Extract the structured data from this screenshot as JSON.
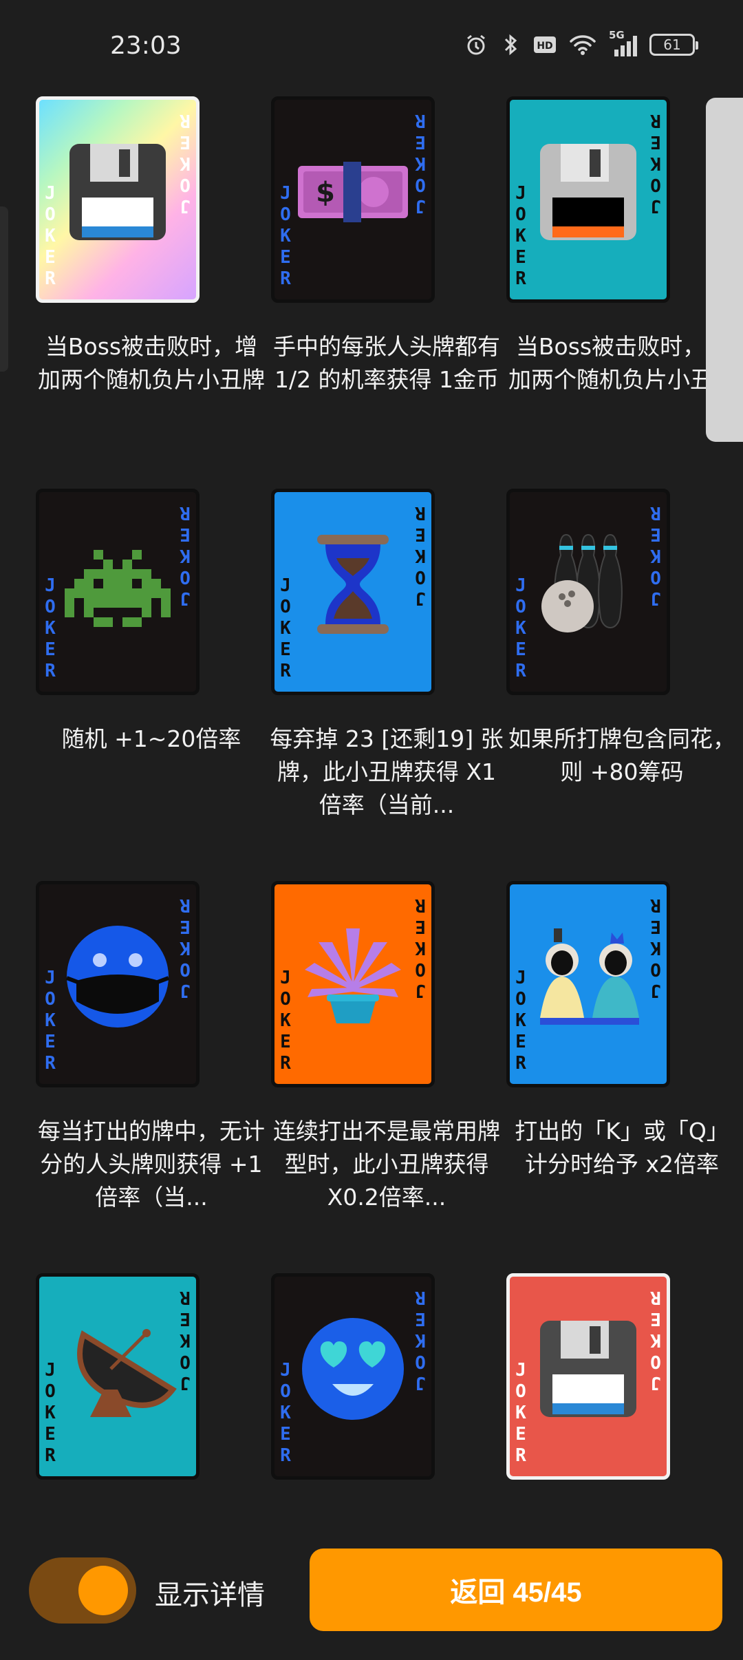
{
  "status_bar": {
    "time": "23:03",
    "battery": "61",
    "network": "5G",
    "icons": [
      "alarm-icon",
      "bluetooth-icon",
      "hd-icon",
      "wifi-icon",
      "signal-icon",
      "battery-icon"
    ]
  },
  "jokers": [
    {
      "description": "当Boss被击败时，增加两个随机负片小丑牌",
      "background": "rainbow",
      "art": "floppy-disk-icon"
    },
    {
      "description": "手中的每张人头牌都有 1/2 的机率获得 1金币",
      "background": "#171313",
      "art": "money-banknote-icon"
    },
    {
      "description": "当Boss被击败时，增加两个随机负片小丑牌",
      "background": "#16aebc",
      "art": "floppy-disk-icon"
    },
    {
      "description": "随机 +1~20倍率",
      "background": "#171313",
      "art": "space-invader-icon"
    },
    {
      "description": "每弃掉 23 [还剩19] 张牌，此小丑牌获得 X1倍率（当前...",
      "background": "#1a8fea",
      "art": "hourglass-icon"
    },
    {
      "description": "如果所打牌包含同花，则 +80筹码",
      "background": "#171313",
      "art": "bowling-icon"
    },
    {
      "description": "每当打出的牌中，无计分的人头牌则获得 +1倍率（当...",
      "background": "#171313",
      "art": "masked-face-icon"
    },
    {
      "description": "连续打出不是最常用牌型时，此小丑牌获得 X0.2倍率...",
      "background": "#ff6a00",
      "art": "fern-plant-icon"
    },
    {
      "description": "打出的「K」或「Q」计分时给予 x2倍率",
      "background": "#1a8fea",
      "art": "hina-dolls-icon"
    },
    {
      "description": "",
      "background": "#16aebc",
      "art": "satellite-dish-icon"
    },
    {
      "description": "",
      "background": "#171313",
      "art": "heart-eyes-face-icon"
    },
    {
      "description": "",
      "background": "#e8564a",
      "art": "floppy-disk-icon"
    }
  ],
  "card_label": "JOKER",
  "bottom": {
    "toggle_label": "显示详情",
    "toggle_on": true,
    "return_label": "返回 45/45"
  },
  "colors": {
    "accent": "#ff9800",
    "background": "#1e1e1e",
    "joker_text": "#2f6df0"
  }
}
